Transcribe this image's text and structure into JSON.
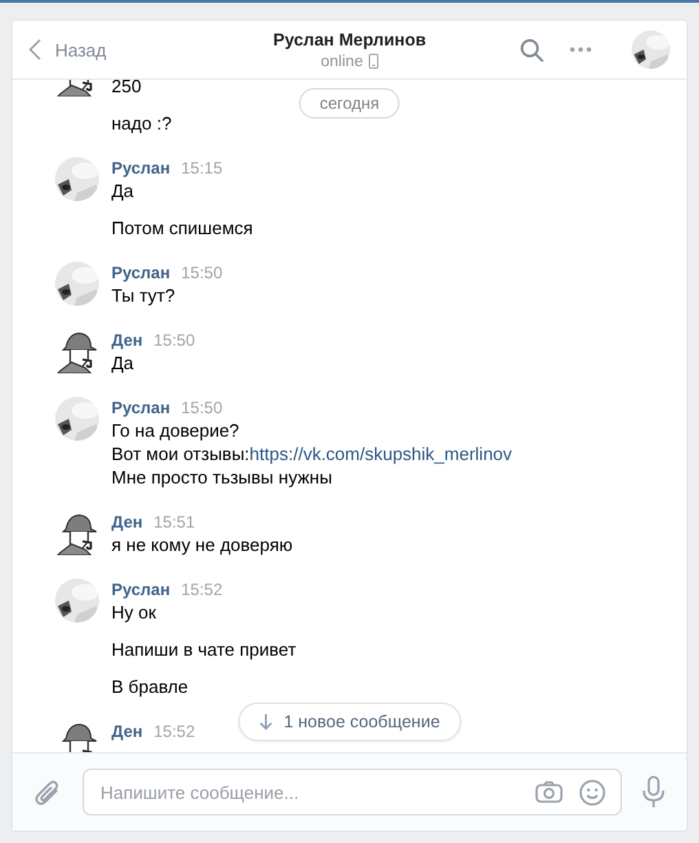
{
  "header": {
    "back_label": "Назад",
    "title": "Руслан Мерлинов",
    "status": "online",
    "avatar": {
      "kind": "photo"
    }
  },
  "date_divider": "сегодня",
  "groups": [
    {
      "avatar": {
        "kind": "detective"
      },
      "messages": [
        {
          "lines": [
            {
              "text": "250"
            }
          ]
        },
        {
          "lines": [
            {
              "text": "надо :?"
            }
          ]
        }
      ]
    },
    {
      "avatar": {
        "kind": "photo"
      },
      "author": "Руслан",
      "time": "15:15",
      "messages": [
        {
          "lines": [
            {
              "text": "Да"
            }
          ]
        },
        {
          "lines": [
            {
              "text": "Потом спишемся"
            }
          ]
        }
      ]
    },
    {
      "avatar": {
        "kind": "photo"
      },
      "author": "Руслан",
      "time": "15:50",
      "messages": [
        {
          "lines": [
            {
              "text": "Ты тут?"
            }
          ]
        }
      ]
    },
    {
      "avatar": {
        "kind": "detective"
      },
      "author": "Ден",
      "time": "15:50",
      "messages": [
        {
          "lines": [
            {
              "text": "Да"
            }
          ]
        }
      ]
    },
    {
      "avatar": {
        "kind": "photo"
      },
      "author": "Руслан",
      "time": "15:50",
      "messages": [
        {
          "lines": [
            {
              "text": "Го на доверие?"
            },
            {
              "text": "Вот мои отзывы:",
              "link": "https://vk.com/skupshik_merlinov"
            },
            {
              "text": "Мне просто тьзывы нужны"
            }
          ]
        }
      ]
    },
    {
      "avatar": {
        "kind": "detective"
      },
      "author": "Ден",
      "time": "15:51",
      "messages": [
        {
          "lines": [
            {
              "text": "я не кому не доверяю"
            }
          ]
        }
      ]
    },
    {
      "avatar": {
        "kind": "photo"
      },
      "author": "Руслан",
      "time": "15:52",
      "messages": [
        {
          "lines": [
            {
              "text": "Ну ок"
            }
          ]
        },
        {
          "lines": [
            {
              "text": "Напиши в чате привет"
            }
          ]
        },
        {
          "lines": [
            {
              "text": "В бравле"
            }
          ]
        }
      ]
    },
    {
      "avatar": {
        "kind": "detective"
      },
      "author": "Ден",
      "time": "15:52"
    }
  ],
  "new_messages_button": "1 новое сообщение",
  "composer": {
    "placeholder": "Напишите сообщение..."
  }
}
